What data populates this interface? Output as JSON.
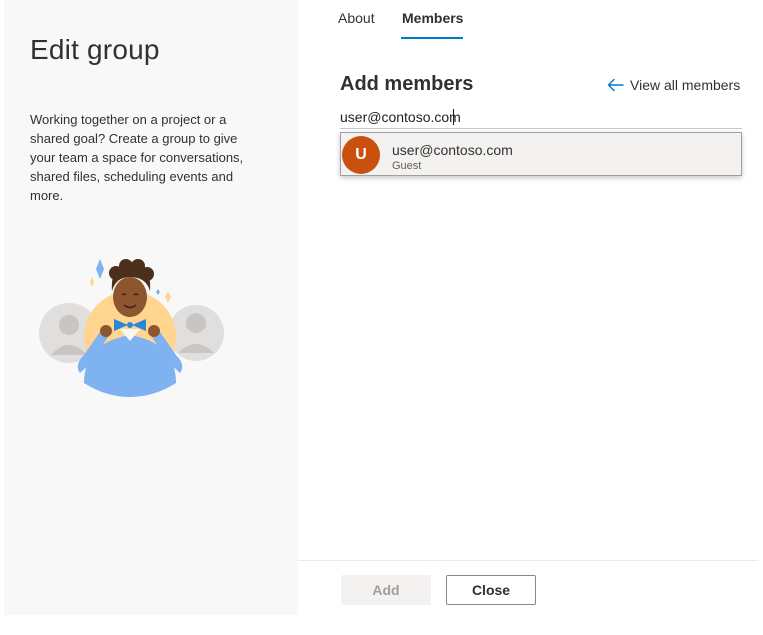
{
  "left": {
    "title": "Edit group",
    "description": "Working together on a project or a shared goal? Create a group to give your team a space for conversations, shared files, scheduling events and more."
  },
  "tabs": [
    {
      "label": "About",
      "selected": false
    },
    {
      "label": "Members",
      "selected": true
    }
  ],
  "members": {
    "section_title": "Add members",
    "view_all_label": "View all members",
    "search_value": "user@contoso.com",
    "suggestions": [
      {
        "initial": "U",
        "name": "user@contoso.com",
        "type": "Guest",
        "avatar_color": "#ca5010"
      }
    ]
  },
  "footer": {
    "add_label": "Add",
    "add_disabled": true,
    "close_label": "Close"
  },
  "colors": {
    "accent": "#0078d4",
    "avatar": "#ca5010",
    "left_pane_bg": "#f8f8f8"
  },
  "icons": {
    "view_all": "arrow-left-icon",
    "illustration": "team-illustration"
  }
}
